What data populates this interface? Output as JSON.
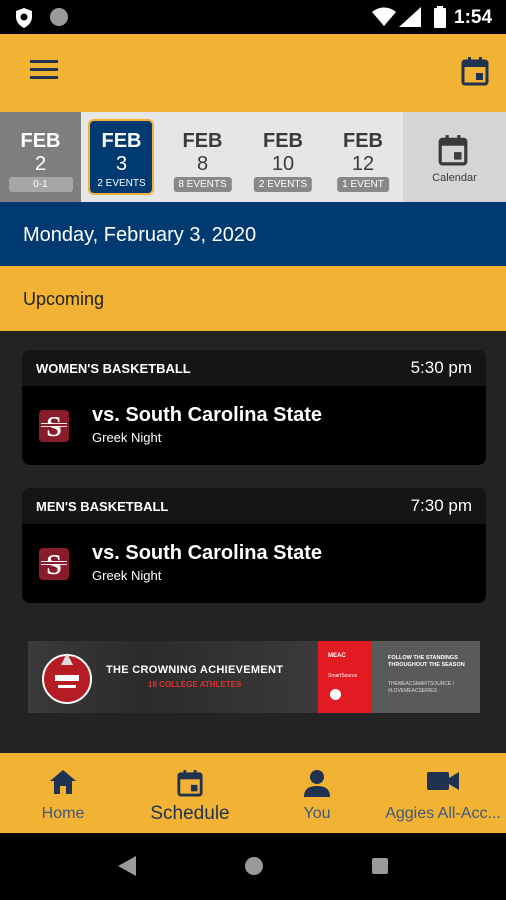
{
  "status_bar": {
    "time": "1:54",
    "icons": [
      "shield-icon",
      "circle-icon",
      "wifi-icon",
      "signal-icon",
      "battery-icon"
    ]
  },
  "app_bar": {
    "icons": [
      "menu-icon",
      "calendar-icon"
    ],
    "accent_color": "#F2B233"
  },
  "date_strip": {
    "items": [
      {
        "month": "FEB",
        "day": "2",
        "badge": "0-1",
        "state": "past"
      },
      {
        "month": "FEB",
        "day": "3",
        "badge": "2 EVENTS",
        "state": "selected"
      },
      {
        "month": "FEB",
        "day": "8",
        "badge": "8 EVENTS",
        "state": "upcoming"
      },
      {
        "month": "FEB",
        "day": "10",
        "badge": "2 EVENTS",
        "state": "upcoming"
      },
      {
        "month": "FEB",
        "day": "12",
        "badge": "1 EVENT",
        "state": "upcoming"
      }
    ],
    "calendar_label": "Calendar"
  },
  "date_header": {
    "text": "Monday, February 3, 2020",
    "color": "#003A70"
  },
  "section": {
    "label": "Upcoming"
  },
  "events": [
    {
      "sport": "WOMEN'S BASKETBALL",
      "time": "5:30 pm",
      "opponent": "vs. South Carolina State",
      "promo": "Greek Night"
    },
    {
      "sport": "MEN'S BASKETBALL",
      "time": "7:30 pm",
      "opponent": "vs. South Carolina State",
      "promo": "Greek Night"
    }
  ],
  "ad": {
    "title": "THE CROWNING ACHIEVEMENT",
    "subtitle": "18 COLLEGE ATHLETES",
    "red_line1": "MEAC",
    "red_line2": "SmartSource",
    "right_line1": "FOLLOW THE STANDINGS THROUGHOUT THE SEASON",
    "right_line2": "THEMEACSMARTSOURCE / #LOVEMEACSERIES"
  },
  "bottom_nav": {
    "items": [
      {
        "label": "Home",
        "icon": "home-icon"
      },
      {
        "label": "Schedule",
        "icon": "calendar-icon",
        "active": true
      },
      {
        "label": "You",
        "icon": "person-icon"
      },
      {
        "label": "Aggies All-Acc...",
        "icon": "video-camera-icon"
      }
    ]
  },
  "system_nav": {
    "icons": [
      "back-icon",
      "home-circle-icon",
      "recents-icon"
    ]
  }
}
